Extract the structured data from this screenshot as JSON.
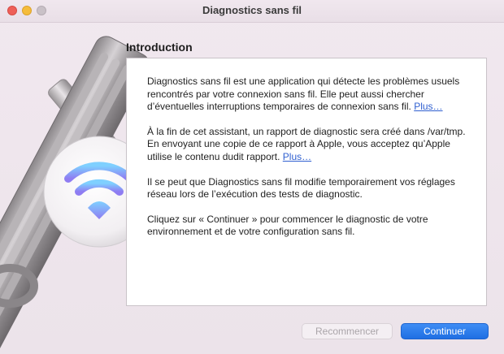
{
  "window": {
    "title": "Diagnostics sans fil"
  },
  "section": {
    "title": "Introduction"
  },
  "content": {
    "paragraph1_text": "Diagnostics sans fil est une application qui détecte les problèmes usuels rencontrés par votre connexion sans fil. Elle peut aussi chercher d’éventuelles interruptions temporaires de connexion sans fil.",
    "paragraph1_link": "Plus…",
    "paragraph2_text": "À la fin de cet assistant, un rapport de diagnostic sera créé dans /var/tmp. En envoyant une copie de ce rapport à Apple, vous acceptez qu’Apple utilise le contenu dudit rapport.",
    "paragraph2_link": "Plus…",
    "paragraph3_text": "Il se peut que Diagnostics sans fil modifie temporairement vos réglages réseau lors de l’exécution des tests de diagnostic.",
    "paragraph4_text": "Cliquez sur « Continuer » pour commencer le diagnostic de votre environnement et de votre configuration sans fil."
  },
  "buttons": {
    "restart_label": "Recommencer",
    "restart_state": "disabled",
    "continue_label": "Continuer"
  },
  "colors": {
    "accent": "#2a7ae9",
    "link": "#2f5fd0",
    "close": "#ee5f58",
    "minimize": "#f5bc3b",
    "maximize_inactive": "#c9c1c7"
  },
  "icons": {
    "app_artwork": "wrench-and-wifi-icon"
  }
}
